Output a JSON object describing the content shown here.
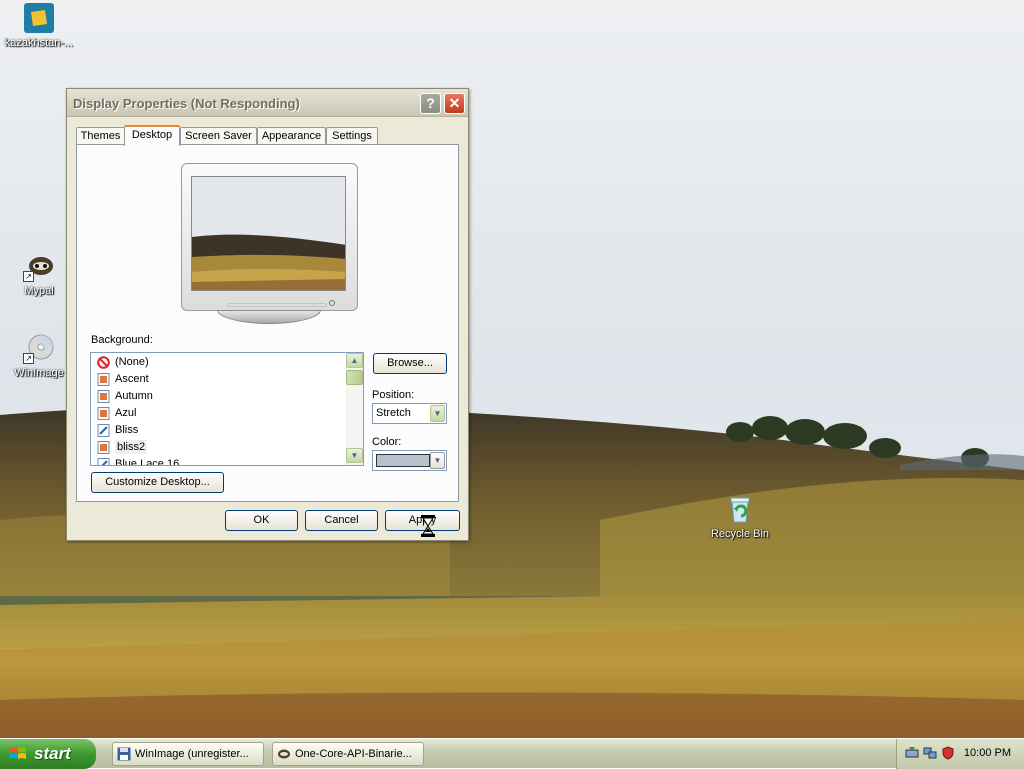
{
  "desktop": {
    "icons": [
      {
        "label": "kazakhstan-..."
      },
      {
        "label": "Mypal"
      },
      {
        "label": "WinImage"
      },
      {
        "label": "Recycle Bin"
      }
    ]
  },
  "window": {
    "title": "Display Properties (Not Responding)",
    "help_label": "?",
    "close_label": "✕",
    "tabs": [
      {
        "label": "Themes"
      },
      {
        "label": "Desktop"
      },
      {
        "label": "Screen Saver"
      },
      {
        "label": "Appearance"
      },
      {
        "label": "Settings"
      }
    ],
    "active_tab": "Desktop",
    "background_label": "Background:",
    "background_list": [
      {
        "label": "(None)",
        "icon": "none-icon"
      },
      {
        "label": "Ascent",
        "icon": "image-file-icon"
      },
      {
        "label": "Autumn",
        "icon": "image-file-icon"
      },
      {
        "label": "Azul",
        "icon": "image-file-icon"
      },
      {
        "label": "Bliss",
        "icon": "bitmap-file-icon"
      },
      {
        "label": "bliss2",
        "icon": "image-file-icon",
        "selected": true
      },
      {
        "label": "Blue Lace 16",
        "icon": "bitmap-file-icon"
      }
    ],
    "browse_label": "Browse...",
    "position_label": "Position:",
    "position_value": "Stretch",
    "color_label": "Color:",
    "color_value": "#b4c2cf",
    "customize_label": "Customize Desktop...",
    "ok_label": "OK",
    "cancel_label": "Cancel",
    "apply_label": "Apply"
  },
  "taskbar": {
    "start_label": "start",
    "tasks": [
      {
        "label": "WinImage (unregister..."
      },
      {
        "label": "One-Core-API-Binarie..."
      }
    ],
    "clock": "10:00 PM"
  }
}
